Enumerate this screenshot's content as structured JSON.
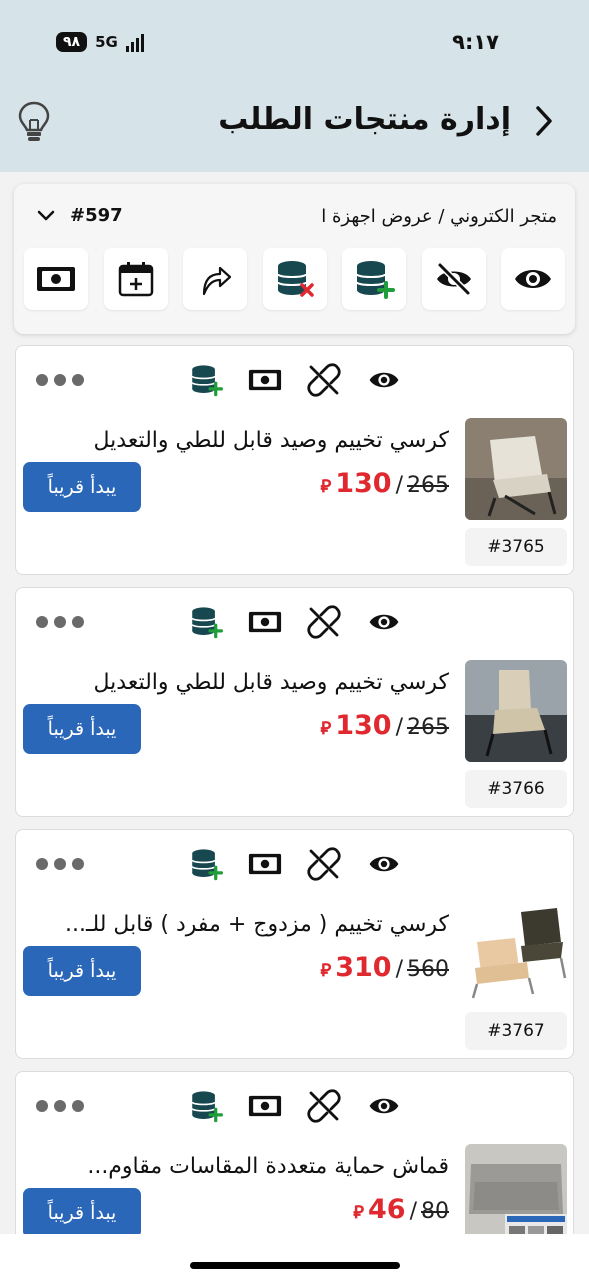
{
  "status_bar": {
    "time": "٩:١٧",
    "battery": "٩٨",
    "network": "5G"
  },
  "header": {
    "title": "إدارة منتجات الطلب",
    "icons": {
      "back": "chevron-right-icon",
      "tip": "lightbulb-icon"
    },
    "bg_color": "#d6e3e8"
  },
  "order_panel": {
    "breadcrumb": "متجر الكتروني / عروض اجهزة ا",
    "order_id": "#597",
    "tools": [
      {
        "name": "view",
        "icon": "eye-icon"
      },
      {
        "name": "hide",
        "icon": "eye-off-icon"
      },
      {
        "name": "add-db",
        "icon": "database-add-icon"
      },
      {
        "name": "remove-db",
        "icon": "database-remove-icon"
      },
      {
        "name": "share",
        "icon": "share-arrow-icon"
      },
      {
        "name": "schedule",
        "icon": "calendar-add-icon"
      },
      {
        "name": "cash",
        "icon": "cash-icon"
      }
    ]
  },
  "products": [
    {
      "title": "كرسي تخييم وصيد قابل للطي والتعديل",
      "old_price": "265",
      "new_price": "130",
      "sku": "#3765",
      "button": "يبدأ قريباً"
    },
    {
      "title": "كرسي تخييم وصيد قابل للطي والتعديل",
      "old_price": "265",
      "new_price": "130",
      "sku": "#3766",
      "button": "يبدأ قريباً"
    },
    {
      "title": "كرسي تخييم ( مزدوج + مفرد ) قابل للـ...",
      "old_price": "560",
      "new_price": "310",
      "sku": "#3767",
      "button": "يبدأ قريباً"
    },
    {
      "title": "قماش حماية متعددة المقاسات مقاوم...",
      "old_price": "80",
      "new_price": "46",
      "sku": "",
      "button": "يبدأ قريباً"
    }
  ],
  "card_action_icons": [
    "eye-icon",
    "unlink-icon",
    "cash-icon",
    "database-add-icon",
    "more-dots-icon"
  ],
  "colors": {
    "accent": "#2a67b8",
    "price_red": "#e0282f",
    "db_green": "#1f9d3a",
    "db_dark": "#17474f"
  },
  "currency_symbol": "⃁"
}
